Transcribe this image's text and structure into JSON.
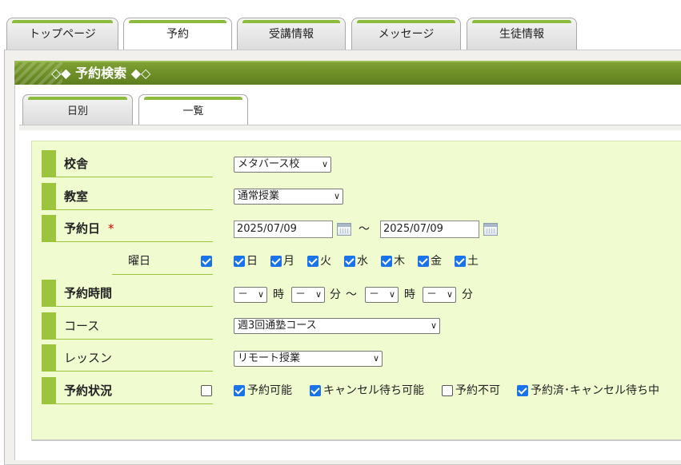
{
  "main_tabs": [
    "トップページ",
    "予約",
    "受講情報",
    "メッセージ",
    "生徒情報"
  ],
  "header": {
    "title": "◇◆ 予約検索 ◆◇"
  },
  "sub_tabs": [
    "日別",
    "一覧"
  ],
  "form": {
    "school_label": "校舎",
    "school_value": "メタバース校",
    "room_label": "教室",
    "room_value": "通常授業",
    "date_label": "予約日",
    "required_mark": "*",
    "date_from": "2025/07/09",
    "date_sep": "～",
    "date_to": "2025/07/09",
    "weekday_label": "曜日",
    "weekdays": [
      "日",
      "月",
      "火",
      "水",
      "木",
      "金",
      "土"
    ],
    "time_label": "予約時間",
    "time_placeholder": "－",
    "hour_unit": "時",
    "minute_unit": "分",
    "time_sep": "～",
    "course_label": "コース",
    "course_value": "週3回通塾コース",
    "lesson_label": "レッスン",
    "lesson_value": "リモート授業",
    "status_label": "予約状況",
    "statuses": [
      {
        "label": "予約可能",
        "checked": true
      },
      {
        "label": "キャンセル待ち可能",
        "checked": true
      },
      {
        "label": "予約不可",
        "checked": false
      },
      {
        "label": "予約済･キャンセル待ち中",
        "checked": true
      }
    ]
  },
  "colors": {
    "accent_green": "#9cc43c",
    "header_green": "#6b8c27",
    "form_bg": "#f0fbd0",
    "checkbox_blue": "#1a73e8",
    "required_red": "#cc0000"
  }
}
